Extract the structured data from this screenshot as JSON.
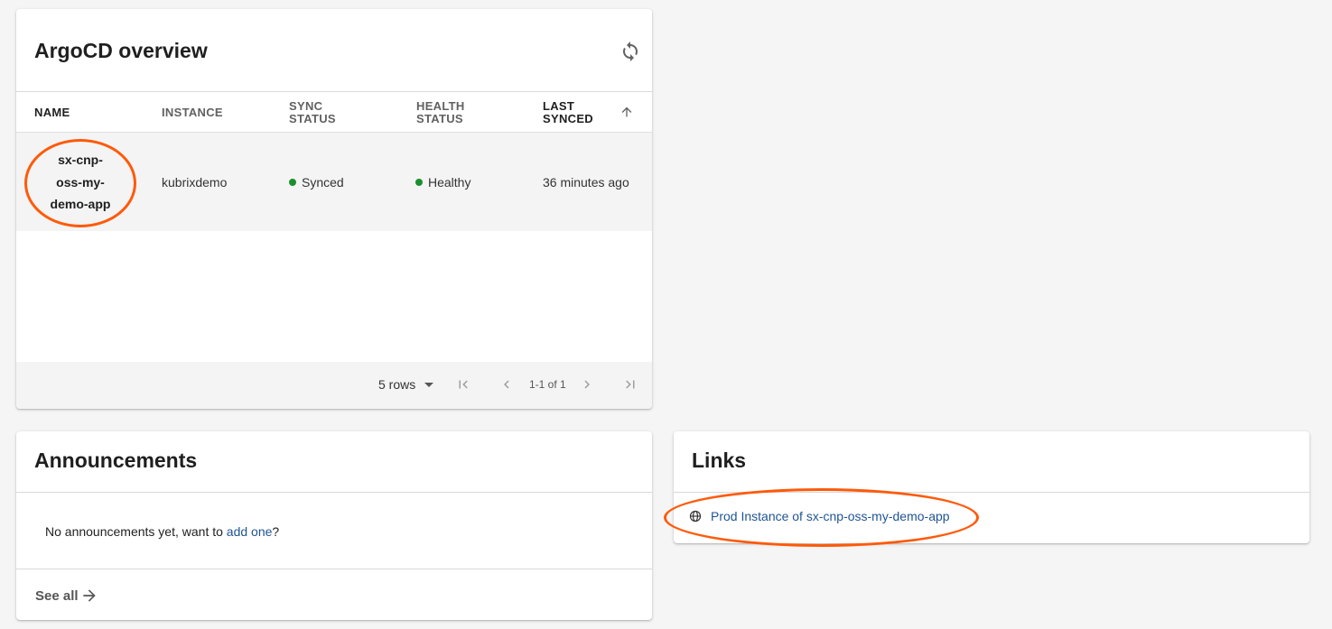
{
  "argocd": {
    "title": "ArgoCD overview",
    "columns": {
      "name": "NAME",
      "instance": "INSTANCE",
      "sync_status_line1": "SYNC",
      "sync_status_line2": "STATUS",
      "health_status_line1": "HEALTH",
      "health_status_line2": "STATUS",
      "last_synced_line1": "LAST",
      "last_synced_line2": "SYNCED"
    },
    "rows": [
      {
        "name_parts": [
          "sx-cnp-",
          "oss-my-",
          "demo-app"
        ],
        "instance": "kubrixdemo",
        "sync_status": "Synced",
        "health_status": "Healthy",
        "last_synced": "36 minutes ago"
      }
    ],
    "pagination": {
      "rows_per_page": "5 rows",
      "range": "1-1 of 1"
    },
    "status_color": "#1b8f2e"
  },
  "announcements": {
    "title": "Announcements",
    "empty_text": "No announcements yet, want to ",
    "add_link": "add one",
    "trailing": "?",
    "see_all": "See all"
  },
  "links": {
    "title": "Links",
    "items": [
      {
        "label": "Prod Instance of sx-cnp-oss-my-demo-app",
        "icon": "globe-icon"
      }
    ]
  },
  "colors": {
    "link": "#1f5493",
    "highlight": "#ff5a0a"
  }
}
